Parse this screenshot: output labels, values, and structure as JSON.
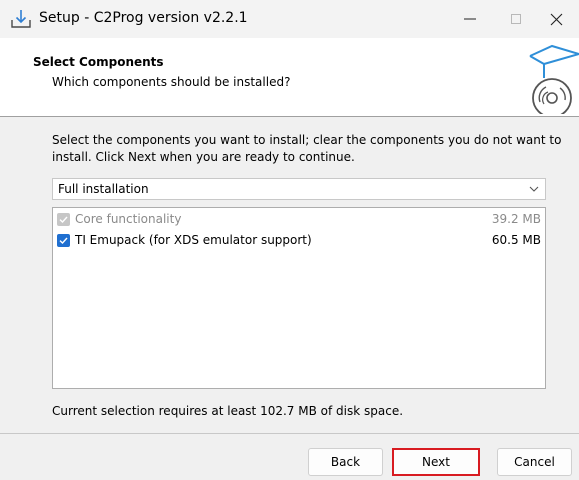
{
  "window": {
    "title": "Setup - C2Prog version v2.2.1"
  },
  "header": {
    "title": "Select Components",
    "subtitle": "Which components should be installed?"
  },
  "body": {
    "intro": "Select the components you want to install; clear the components you do not want to install. Click Next when you are ready to continue.",
    "installation_type": "Full installation",
    "components": [
      {
        "label": "Core functionality",
        "size": "39.2 MB",
        "checked": true,
        "enabled": false
      },
      {
        "label": "TI Emupack (for XDS emulator support)",
        "size": "60.5 MB",
        "checked": true,
        "enabled": true
      }
    ],
    "status": "Current selection requires at least 102.7 MB of disk space."
  },
  "buttons": {
    "back": "Back",
    "next": "Next",
    "cancel": "Cancel"
  },
  "colors": {
    "checkbox_enabled": "#1f6fd0",
    "checkbox_disabled": "#c6c6c6",
    "highlight": "#d81b21"
  }
}
